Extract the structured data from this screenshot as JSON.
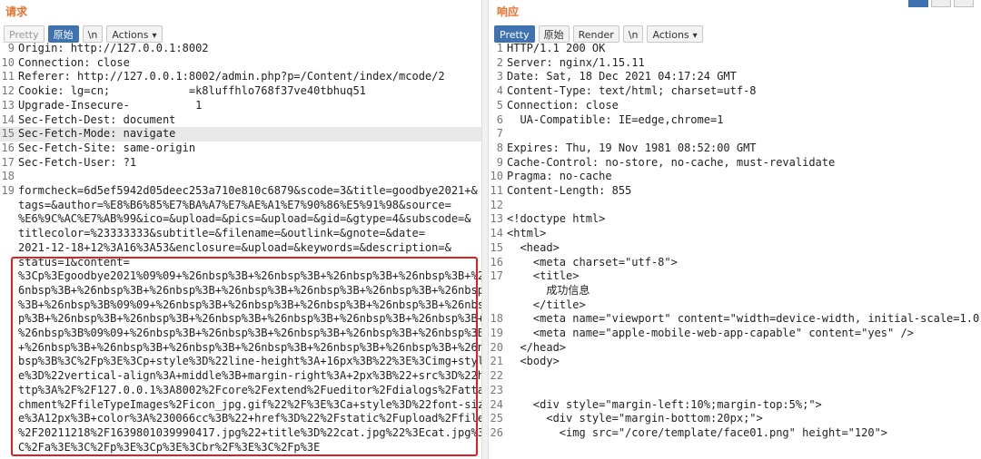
{
  "request": {
    "title": "请求",
    "toolbar": {
      "pretty": "Pretty",
      "raw": "原始",
      "newline": "\\n",
      "actions": "Actions"
    },
    "headers": [
      {
        "n": "9",
        "t": "Origin: http://127.0.0.1:8002"
      },
      {
        "n": "10",
        "t": "Connection: close"
      },
      {
        "n": "11",
        "t": "Referer: http://127.0.0.1:8002/admin.php?p=/Content/index/mcode/2"
      },
      {
        "n": "12",
        "t": "Cookie: lg=cn;            =k8luffhlo768f37ve40tbhuq51"
      },
      {
        "n": "13",
        "t": "Upgrade-Insecure-          1"
      },
      {
        "n": "14",
        "t": "Sec-Fetch-Dest: document"
      },
      {
        "n": "15",
        "t": "Sec-Fetch-Mode: navigate"
      },
      {
        "n": "16",
        "t": "Sec-Fetch-Site: same-origin"
      },
      {
        "n": "17",
        "t": "Sec-Fetch-User: ?1"
      },
      {
        "n": "18",
        "t": ""
      }
    ],
    "body_line_number": "19",
    "body_lines": [
      "formcheck=6d5ef5942d05deec253a710e810c6879&scode=3&title=goodbye2021+&",
      "tags=&author=%E8%B6%85%E7%BA%A7%E7%AE%A1%E7%90%86%E5%91%98&source=",
      "%E6%9C%AC%E7%AB%99&ico=&upload=&pics=&upload=&gid=&gtype=4&subscode=&",
      "titlecolor=%23333333&subtitle=&filename=&outlink=&gnote=&date=",
      "2021-12-18+12%3A16%3A53&enclosure=&upload=&keywords=&description=&",
      "status=1&content=",
      "%3Cp%3Egoodbye2021%09%09+%26nbsp%3B+%26nbsp%3B+%26nbsp%3B+%26nbsp%3B+%2",
      "6nbsp%3B+%26nbsp%3B+%26nbsp%3B+%26nbsp%3B+%26nbsp%3B+%26nbsp%3B+%26nbsp",
      "%3B+%26nbsp%3B%09%09+%26nbsp%3B+%26nbsp%3B+%26nbsp%3B+%26nbsp%3B+%26nbs",
      "p%3B+%26nbsp%3B+%26nbsp%3B+%26nbsp%3B+%26nbsp%3B+%26nbsp%3B+%26nbsp%3B+",
      "%26nbsp%3B%09%09+%26nbsp%3B+%26nbsp%3B+%26nbsp%3B+%26nbsp%3B+%26nbsp%3B",
      "+%26nbsp%3B+%26nbsp%3B+%26nbsp%3B+%26nbsp%3B+%26nbsp%3B+%26nbsp%3B+%26n",
      "bsp%3B%3C%2Fp%3E%3Cp+style%3D%22line-height%3A+16px%3B%22%3E%3Cimg+styl",
      "e%3D%22vertical-align%3A+middle%3B+margin-right%3A+2px%3B%22+src%3D%22h",
      "ttp%3A%2F%2F127.0.0.1%3A8002%2Fcore%2Fextend%2Fueditor%2Fdialogs%2Fatta",
      "chment%2FfileTypeImages%2Ficon_jpg.gif%22%2F%3E%3Ca+style%3D%22font-siz",
      "e%3A12px%3B+color%3A%230066cc%3B%22+href%3D%22%2Fstatic%2Fupload%2Ffile",
      "%2F20211218%2F1639801039990417.jpg%22+title%3D%22cat.jpg%22%3Ecat.jpg%3",
      "C%2Fa%3E%3C%2Fp%3E%3Cp%3E%3Cbr%2F%3E%3C%2Fp%3E"
    ]
  },
  "response": {
    "title": "响应",
    "toolbar": {
      "pretty": "Pretty",
      "raw": "原始",
      "render": "Render",
      "newline": "\\n",
      "actions": "Actions"
    },
    "lines": [
      {
        "n": "1",
        "t": "HTTP/1.1 200 OK"
      },
      {
        "n": "2",
        "t": "Server: nginx/1.15.11"
      },
      {
        "n": "3",
        "t": "Date: Sat, 18 Dec 2021 04:17:24 GMT"
      },
      {
        "n": "4",
        "t": "Content-Type: text/html; charset=utf-8"
      },
      {
        "n": "5",
        "t": "Connection: close"
      },
      {
        "n": "6",
        "t": "  UA-Compatible: IE=edge,chrome=1"
      },
      {
        "n": "7",
        "t": ""
      },
      {
        "n": "8",
        "t": "Expires: Thu, 19 Nov 1981 08:52:00 GMT"
      },
      {
        "n": "9",
        "t": "Cache-Control: no-store, no-cache, must-revalidate"
      },
      {
        "n": "10",
        "t": "Pragma: no-cache"
      },
      {
        "n": "11",
        "t": "Content-Length: 855"
      },
      {
        "n": "12",
        "t": ""
      },
      {
        "n": "13",
        "t": "<!doctype html>"
      },
      {
        "n": "14",
        "t": "<html>"
      },
      {
        "n": "15",
        "t": "  <head>"
      },
      {
        "n": "16",
        "t": "    <meta charset=\"utf-8\">"
      },
      {
        "n": "17",
        "t": "    <title>"
      },
      {
        "n": "",
        "t": "      成功信息"
      },
      {
        "n": "",
        "t": "    </title>"
      },
      {
        "n": "18",
        "t": "    <meta name=\"viewport\" content=\"width=device-width, initial-scale=1.0,"
      },
      {
        "n": "19",
        "t": "    <meta name=\"apple-mobile-web-app-capable\" content=\"yes\" />"
      },
      {
        "n": "20",
        "t": "  </head>"
      },
      {
        "n": "21",
        "t": "  <body>"
      },
      {
        "n": "22",
        "t": ""
      },
      {
        "n": "23",
        "t": ""
      },
      {
        "n": "24",
        "t": "    <div style=\"margin-left:10%;margin-top:5%;\">"
      },
      {
        "n": "25",
        "t": "      <div style=\"margin-bottom:20px;\">"
      },
      {
        "n": "26",
        "t": "        <img src=\"/core/template/face01.png\" height=\"120\">"
      }
    ]
  }
}
